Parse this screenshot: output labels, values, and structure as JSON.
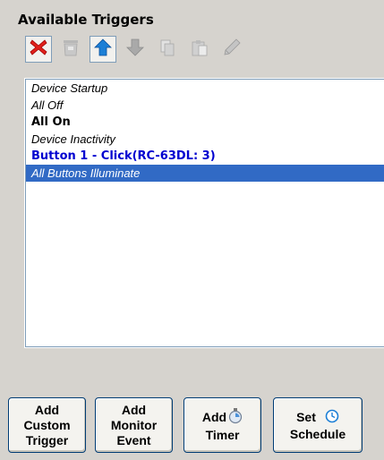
{
  "panel": {
    "title": "Available Triggers"
  },
  "toolbar": {
    "buttons": [
      {
        "icon": "delete-icon",
        "state": "enabled"
      },
      {
        "icon": "trash-icon",
        "state": "disabled"
      },
      {
        "icon": "arrow-up-icon",
        "state": "enabled"
      },
      {
        "icon": "arrow-down-icon",
        "state": "disabled"
      },
      {
        "icon": "copy-icon",
        "state": "disabled"
      },
      {
        "icon": "paste-icon",
        "state": "disabled"
      },
      {
        "icon": "pencil-icon",
        "state": "disabled"
      }
    ]
  },
  "triggers": [
    {
      "label": "Device Startup"
    },
    {
      "label": "All Off"
    },
    {
      "label": "All On"
    },
    {
      "label": "Device Inactivity"
    },
    {
      "label": "Button 1 - Click(RC-63DL: 3)"
    },
    {
      "label": "All Buttons Illuminate",
      "selected": true
    }
  ],
  "buttons": {
    "add_custom_trigger": [
      "Add",
      "Custom",
      "Trigger"
    ],
    "add_monitor_event": [
      "Add",
      "Monitor",
      "Event"
    ],
    "add_timer": [
      "Add",
      "Timer"
    ],
    "set_schedule": [
      "Set",
      "Schedule"
    ]
  },
  "colors": {
    "selection": "#316ac5",
    "link_blue": "#0000d0",
    "delete_red": "#e0201b",
    "up_blue": "#1c7fd6"
  }
}
